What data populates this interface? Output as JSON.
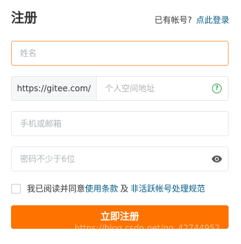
{
  "header": {
    "title": "注册",
    "have_account_text": "已有帐号?",
    "login_link": "点此登录"
  },
  "form": {
    "name_placeholder": "姓名",
    "url_prefix": "https://gitee.com/",
    "personal_space_placeholder": "个人空间地址",
    "phone_email_placeholder": "手机或邮箱",
    "password_placeholder": "密码不少于6位",
    "agreement": {
      "prefix": "我已阅读并同意",
      "terms_link": "使用条款",
      "and": "及",
      "policy_link": "非活跃帐号处理规范"
    },
    "submit_label": "立即注册"
  },
  "icons": {
    "help": "question-circle-icon",
    "password_toggle": "eye-icon"
  },
  "colors": {
    "accent": "#fe7300",
    "link": "#005980",
    "focus_border": "#f9a45a",
    "help_icon": "#38a34a"
  },
  "watermark": "https://blog.csdn.net/qq_42744952"
}
